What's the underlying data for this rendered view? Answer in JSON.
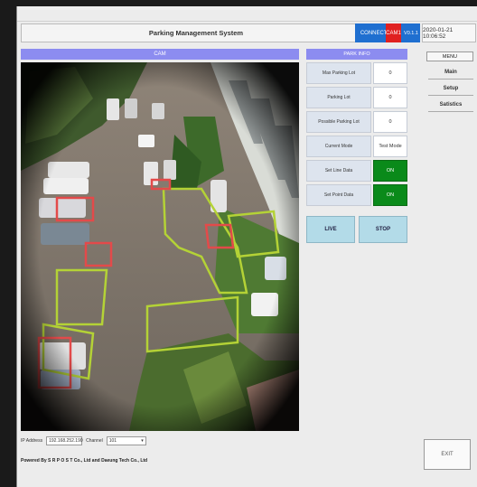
{
  "app": {
    "title": "Parking Management System",
    "connection_label": "CONNECTION",
    "cam_label": "CAM1",
    "version": "V0.1.1",
    "datetime": "2020-01-21 10:06:52"
  },
  "camera": {
    "header": "CAM"
  },
  "park_info": {
    "header": "PARK INFO",
    "rows": [
      {
        "label": "Max Parking Lot",
        "value": "0"
      },
      {
        "label": "Parking Lot",
        "value": "0"
      },
      {
        "label": "Possible Parking Lot",
        "value": "0"
      },
      {
        "label": "Current Mode",
        "value": "Test Mode"
      },
      {
        "label": "Set Line Data",
        "value": "ON"
      },
      {
        "label": "Set Point Data",
        "value": "ON"
      }
    ],
    "live_label": "LIVE",
    "stop_label": "STOP"
  },
  "menu": {
    "header": "MENU",
    "items": [
      "Main",
      "Setup",
      "Satistics"
    ]
  },
  "footer": {
    "ip_label": "IP Address",
    "ip_value": "192.168.252.190",
    "channel_label": "Channel",
    "channel_value": "101",
    "powered_by": "Powered By S R P O S T Co., Ltd and Daeung Tech Co., Ltd",
    "exit_label": "EXIT"
  },
  "colors": {
    "header_purple": "#8c8cf0",
    "on_green": "#0a8a1a",
    "connection_blue": "#1f6fd0",
    "cam_red": "#e02020",
    "button_blue": "#b3dbe8"
  }
}
